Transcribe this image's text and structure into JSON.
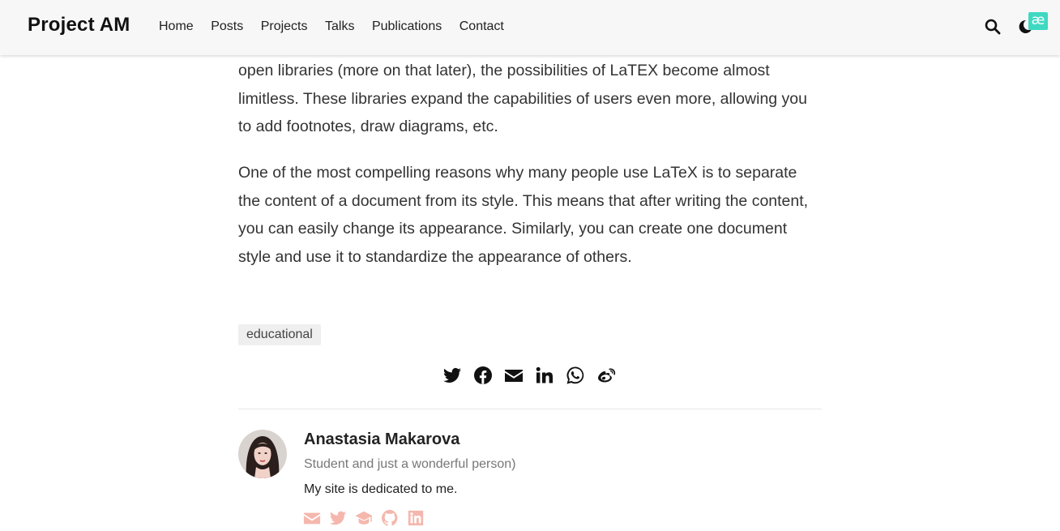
{
  "navbar": {
    "brand": "Project AM",
    "links": [
      "Home",
      "Posts",
      "Projects",
      "Talks",
      "Publications",
      "Contact"
    ],
    "icons": [
      "search-icon",
      "moon-icon"
    ],
    "badge": "æ"
  },
  "article": {
    "paragraph_1": "open libraries (more on that later), the possibilities of LaTEX become almost limitless. These libraries expand the capabilities of users even more, allowing you to add footnotes, draw diagrams, etc.",
    "paragraph_2": "One of the most compelling reasons why many people use LaTeX is to separate the content of a document from its style. This means that after writing the content, you can easily change its appearance. Similarly, you can create one document style and use it to standardize the appearance of others.",
    "tag": "educational"
  },
  "share": {
    "icons": [
      "twitter-icon",
      "facebook-icon",
      "email-icon",
      "linkedin-icon",
      "whatsapp-icon",
      "weibo-icon"
    ]
  },
  "author": {
    "name": "Anastasia Makarova",
    "subtitle": "Student and just a wonderful person)",
    "description": "My site is dedicated to me.",
    "social_icons": [
      "email-icon",
      "twitter-icon",
      "graduation-cap-icon",
      "github-icon",
      "linkedin-icon"
    ],
    "social_color": "#f5b7ad"
  },
  "colors": {
    "navbar_bg": "#f7f7f7",
    "accent_badge": "#3fd9c2",
    "text": "#333333"
  }
}
